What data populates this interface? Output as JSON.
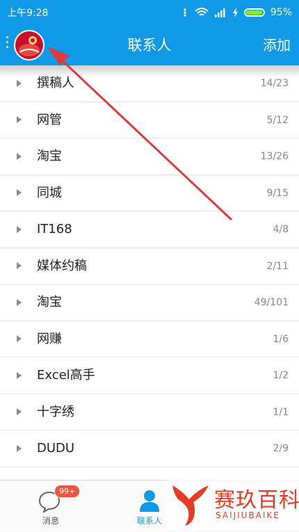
{
  "status_bar": {
    "time": "上午9:28",
    "battery_percent": "95%",
    "battery_level": 0.95,
    "icons": [
      "notification-dots-icon",
      "wifi-icon",
      "signal-icon",
      "charging-icon",
      "battery-icon"
    ]
  },
  "header": {
    "title": "联系人",
    "add_label": "添加",
    "menu_icon": "more-dots-icon",
    "avatar_icon": "user-avatar"
  },
  "groups": [
    {
      "name": "撰稿人",
      "count": "14/23"
    },
    {
      "name": "网管",
      "count": "5/12"
    },
    {
      "name": "淘宝",
      "count": "13/26"
    },
    {
      "name": "同城",
      "count": "9/15"
    },
    {
      "name": "IT168",
      "count": "4/8"
    },
    {
      "name": "媒体约稿",
      "count": "2/11"
    },
    {
      "name": "淘宝",
      "count": "49/101"
    },
    {
      "name": "网赚",
      "count": "1/6"
    },
    {
      "name": "Excel高手",
      "count": "1/2"
    },
    {
      "name": "十字绣",
      "count": "1/1"
    },
    {
      "name": "DUDU",
      "count": "2/9"
    }
  ],
  "tabs": [
    {
      "label": "消息",
      "badge": "99+",
      "icon": "message-bubble-icon"
    },
    {
      "label": "联系人",
      "icon": "contacts-person-icon",
      "active": true
    }
  ],
  "watermark": {
    "text_cn": "赛玖百科",
    "text_en": "SAIJIUBAIKE",
    "icon": "whale-tail-logo"
  },
  "colors": {
    "accent": "#0f99e6",
    "badge": "#f1523e",
    "watermark": "#e73c24",
    "annotation": "#e0393e"
  }
}
